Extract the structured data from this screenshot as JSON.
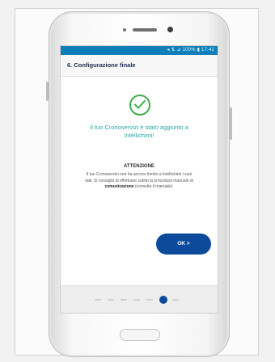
{
  "status_bar": {
    "text": "◂ ⇅ ⊿ 100% ▮ 17:42"
  },
  "app_bar": {
    "title": "6. Configurazione finale"
  },
  "success": {
    "icon": "check-circle-icon",
    "message": "Il tuo Cronoservizi è stato aggiunto a Intellichimi!"
  },
  "attention": {
    "title": "ATTENZIONE",
    "body_pre": "Il tuo Cronoservizi non ha ancora fornito a Intellichimi i suoi dati. Si consiglia di effettuare subito la procedura manuale di",
    "body_bold": "comunicazione",
    "body_post": "(consulta il manuale)."
  },
  "ok_button": {
    "label": "OK >"
  },
  "pager": {
    "total": 7,
    "active_index": 5
  },
  "colors": {
    "status_bar": "#0e7fb8",
    "success_green": "#3fae49",
    "message_teal": "#2aa7a7",
    "primary_blue": "#0c4a9b"
  }
}
